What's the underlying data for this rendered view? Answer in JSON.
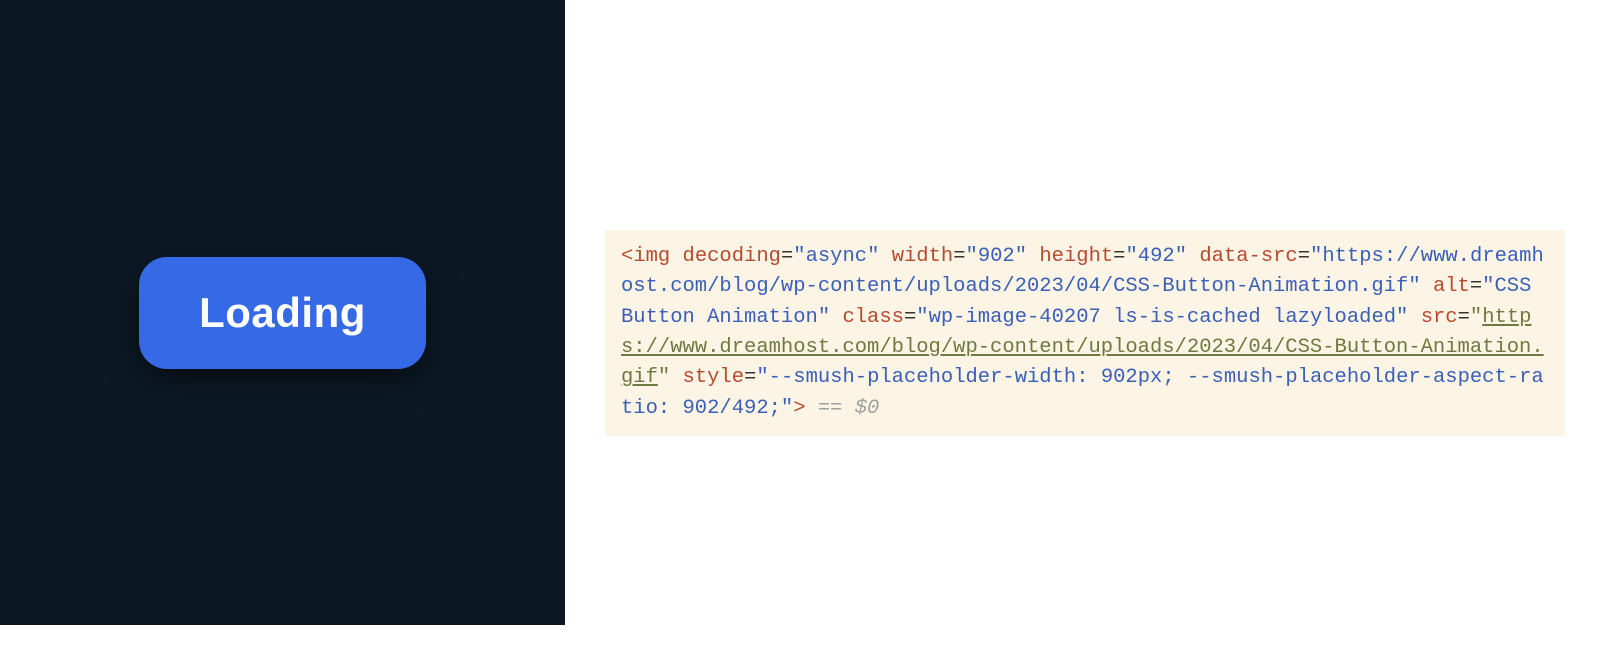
{
  "left": {
    "button_label": "Loading"
  },
  "right": {
    "code": {
      "tag_open": "<",
      "tag_name": "img",
      "attr_decoding_name": "decoding",
      "attr_decoding_value": "\"async\"",
      "attr_width_name": "width",
      "attr_width_value": "\"902\"",
      "attr_height_name": "height",
      "attr_height_value": "\"492\"",
      "attr_datasrc_name": "data-src",
      "attr_datasrc_value": "\"https://www.dreamhost.com/blog/wp-content/uploads/2023/04/CSS-Button-Animation.gif\"",
      "attr_alt_name": "alt",
      "attr_alt_value": "\"CSS Button Animation\"",
      "attr_class_name": "class",
      "attr_class_value": "\"wp-image-40207 ls-is-cached lazyloaded\"",
      "attr_src_name": "src",
      "attr_src_quote_open": "\"",
      "attr_src_value_link": "https://www.dreamhost.com/blog/wp-content/uploads/2023/04/CSS-Button-Animation.gif",
      "attr_src_quote_close": "\"",
      "attr_style_name": "style",
      "attr_style_value": "\"--smush-placeholder-width: 902px; --smush-placeholder-aspect-ratio: 902/492;\"",
      "tag_close": ">",
      "console_marker": " == $0",
      "eq": "=",
      "space": " "
    }
  }
}
